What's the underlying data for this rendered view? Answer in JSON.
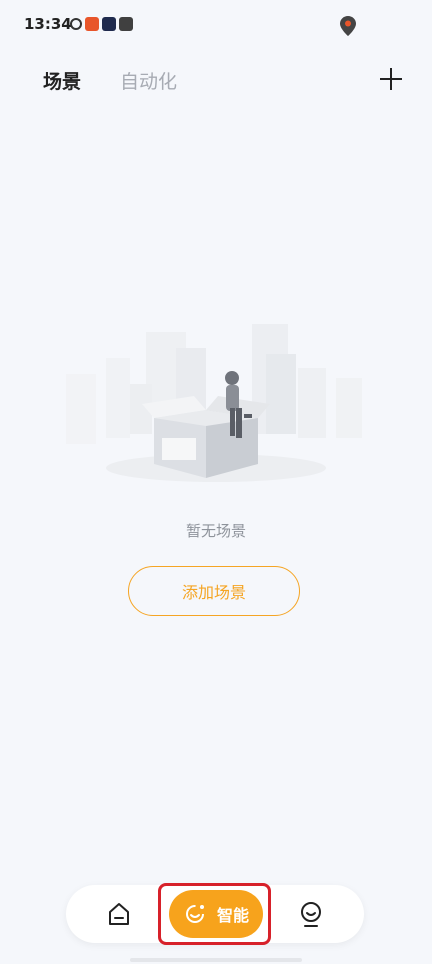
{
  "status_bar": {
    "time": "13:34"
  },
  "header": {
    "tabs": [
      {
        "label": "场景",
        "active": true
      },
      {
        "label": "自动化",
        "active": false
      }
    ]
  },
  "empty_state": {
    "message": "暂无场景",
    "button_label": "添加场景"
  },
  "bottom_nav": {
    "smart_label": "智能"
  },
  "colors": {
    "accent": "#f7a31c",
    "background": "#f5f7fb",
    "highlight": "#d7212a"
  }
}
